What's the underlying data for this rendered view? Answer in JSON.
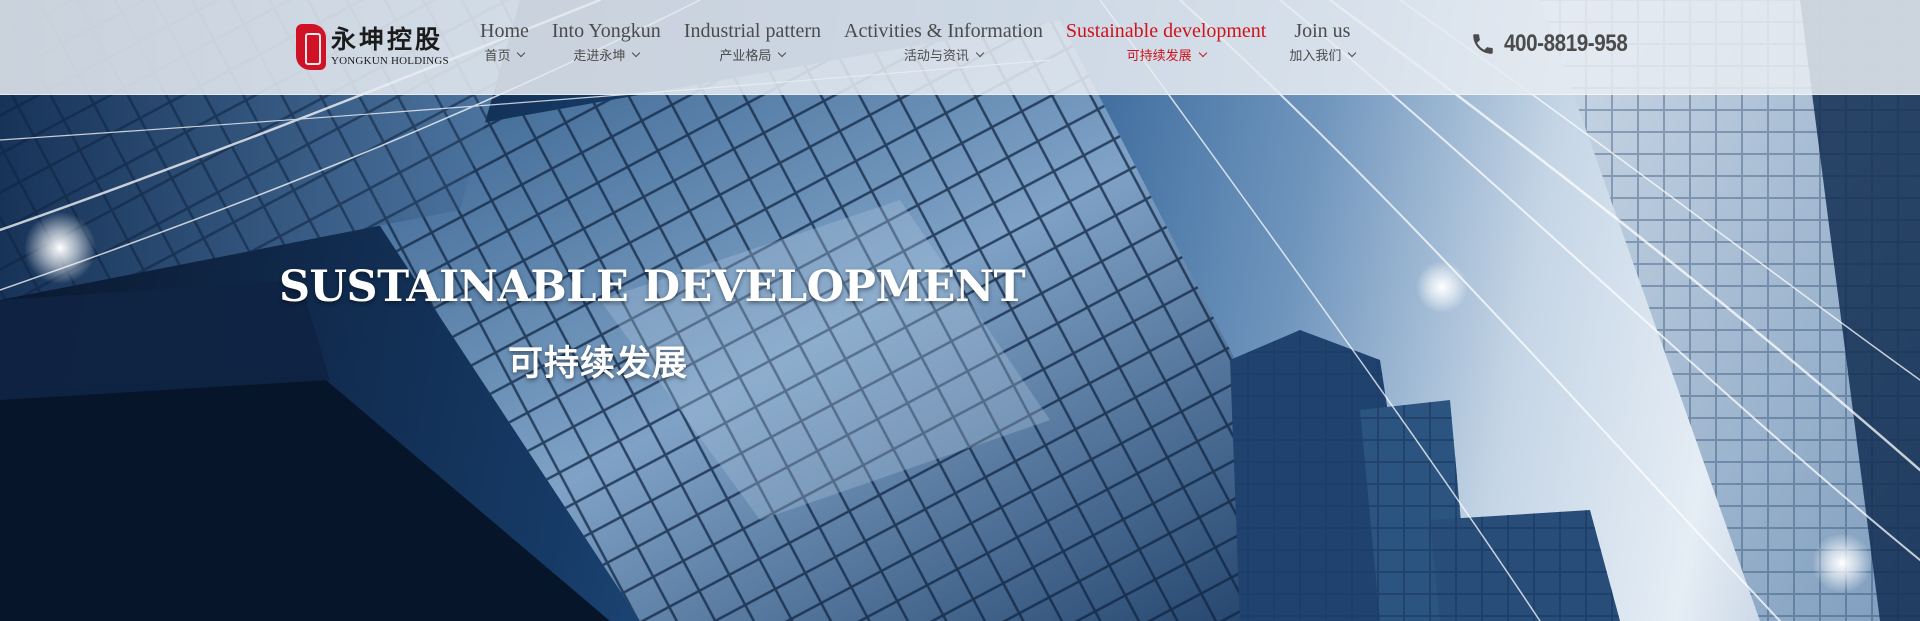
{
  "brand": {
    "name_cn": "永坤控股",
    "name_en": "YONGKUN HOLDINGS",
    "seal_color": "#d01227"
  },
  "nav": {
    "items": [
      {
        "en": "Home",
        "cn": "首页",
        "active": false
      },
      {
        "en": "Into Yongkun",
        "cn": "走进永坤",
        "active": false
      },
      {
        "en": "Industrial pattern",
        "cn": "产业格局",
        "active": false
      },
      {
        "en": "Activities & Information",
        "cn": "活动与资讯",
        "active": false
      },
      {
        "en": "Sustainable development",
        "cn": "可持续发展",
        "active": true
      },
      {
        "en": "Join us",
        "cn": "加入我们",
        "active": false
      }
    ],
    "active_color": "#d0121b",
    "text_color": "#4b4b4b"
  },
  "contact": {
    "phone": "400-8819-958",
    "icon": "phone-icon"
  },
  "hero": {
    "title": "SUSTAINABLE DEVELOPMENT",
    "subtitle": "可持续发展"
  }
}
